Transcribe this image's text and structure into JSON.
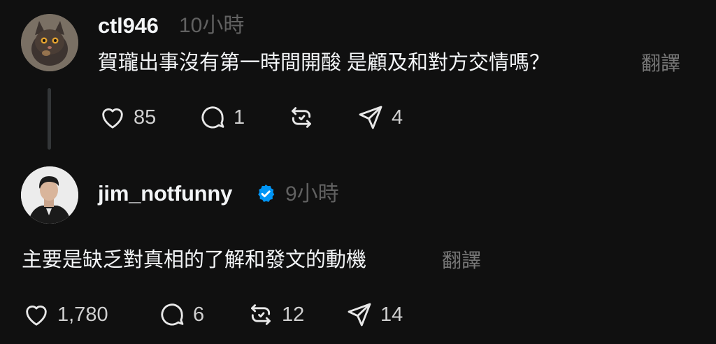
{
  "comments": [
    {
      "username": "ctl946",
      "time": "10小時",
      "text": "賀瓏出事沒有第一時間開酸 是顧及和對方交情嗎？",
      "translate_label": "翻譯",
      "verified": false,
      "avatar": "cat-avatar",
      "stats": {
        "likes": "85",
        "replies": "1",
        "reposts": "",
        "shares": "4"
      }
    },
    {
      "username": "jim_notfunny",
      "time": "9小時",
      "text": "主要是缺乏對真相的了解和發文的動機",
      "translate_label": "翻譯",
      "verified": true,
      "avatar": "man-avatar",
      "stats": {
        "likes": "1,780",
        "replies": "6",
        "reposts": "12",
        "shares": "14"
      }
    }
  ],
  "colors": {
    "background": "#101010",
    "text": "#f3f5f7",
    "muted": "#616161",
    "verified_blue": "#0095f6",
    "thread_line": "#333638"
  },
  "icons": [
    "heart-icon",
    "comment-icon",
    "repost-icon",
    "share-icon",
    "verified-badge-icon"
  ]
}
